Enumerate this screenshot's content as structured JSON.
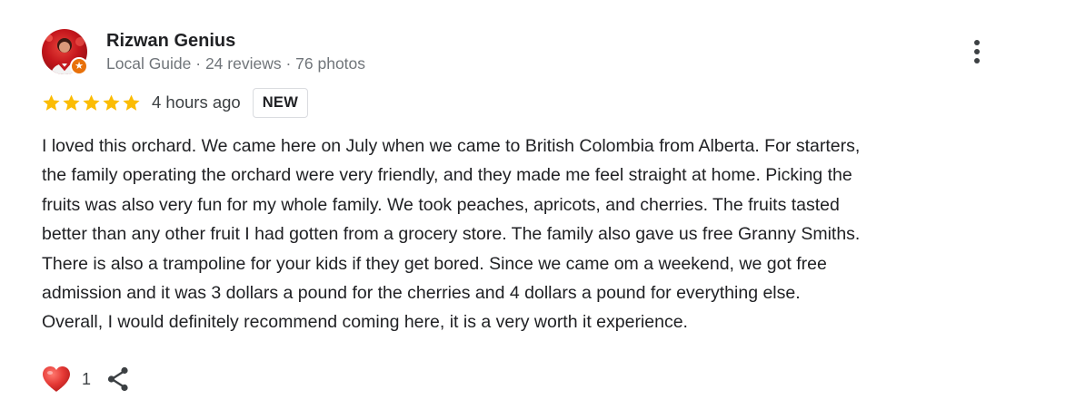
{
  "reviewer": {
    "name": "Rizwan Genius",
    "meta": "Local Guide · 24 reviews · 76 photos",
    "avatar_icon": "user-avatar-photo",
    "badge_icon": "local-guide-star-icon",
    "badge_color": "#e8710a"
  },
  "rating": {
    "stars": 5,
    "max_stars": 5,
    "star_color": "#fbbc04",
    "time": "4 hours ago",
    "badge": "NEW"
  },
  "review": {
    "lines": [
      "I loved this orchard. We came here on July when we came to British Colombia from Alberta. For starters,",
      "the family operating the orchard were very friendly, and they made me feel straight at home. Picking the",
      "fruits was also very fun for my whole family. We took peaches, apricots, and cherries. The fruits tasted",
      "better than any other fruit I had gotten from a grocery store. The family also gave us free Granny Smiths.",
      "There is also a trampoline for your kids if they get bored. Since we came om a weekend, we got free",
      "admission and it was 3 dollars a pound for the cherries and 4 dollars a pound for everything else.",
      "Overall, I would definitely recommend coming here, it is a very worth it experience."
    ]
  },
  "actions": {
    "like_icon": "heart-icon",
    "like_count": "1",
    "share_icon": "share-icon",
    "more_icon": "more-vert-icon",
    "heart_color": "#e53935"
  }
}
